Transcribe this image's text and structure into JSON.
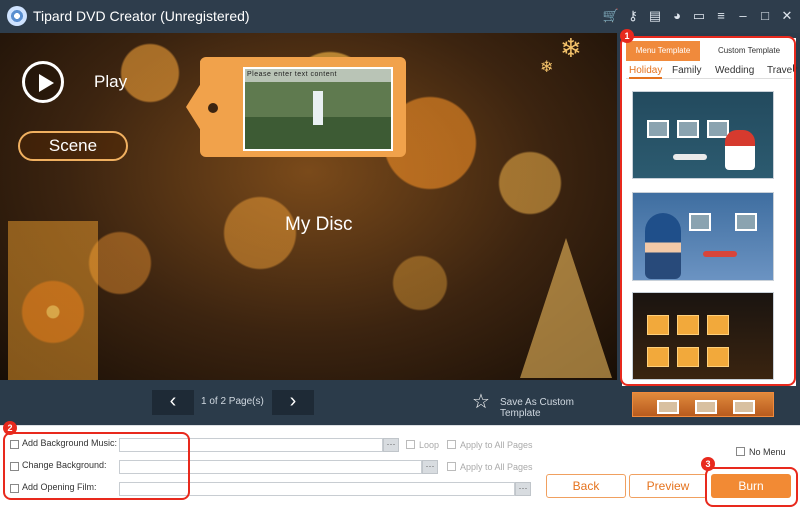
{
  "window": {
    "title": "Tipard DVD Creator (Unregistered)",
    "controls": [
      "cart-icon",
      "key-icon",
      "register-icon",
      "chat-icon",
      "feedback-icon",
      "minimize-icon",
      "maximize-icon",
      "close-icon"
    ]
  },
  "preview": {
    "play_label": "Play",
    "scene_label": "Scene",
    "disc_title": "My Disc",
    "tag_caption": "Please enter text content"
  },
  "pager": {
    "prev": "‹",
    "next": "›",
    "page_text": "1 of 2 Page(s)",
    "save_template": "Save As Custom Template"
  },
  "panel": {
    "tabs": [
      "Menu Template",
      "Custom Template"
    ],
    "subtabs": [
      "Holiday",
      "Family",
      "Wedding",
      "Travel"
    ]
  },
  "options": {
    "bg_music": "Add Background Music:",
    "change_bg": "Change Background:",
    "opening_film": "Add Opening Film:",
    "loop": "Loop",
    "apply_all": "Apply to All Pages",
    "apply_all_2": "Apply to All Pages",
    "browse": "···",
    "no_menu": "No Menu"
  },
  "buttons": {
    "back": "Back",
    "preview": "Preview",
    "burn": "Burn"
  },
  "badges": [
    "1",
    "2",
    "3"
  ],
  "colors": {
    "accent": "#f28a34",
    "highlight": "#e8291d",
    "title_bar": "#2e3d4c"
  }
}
